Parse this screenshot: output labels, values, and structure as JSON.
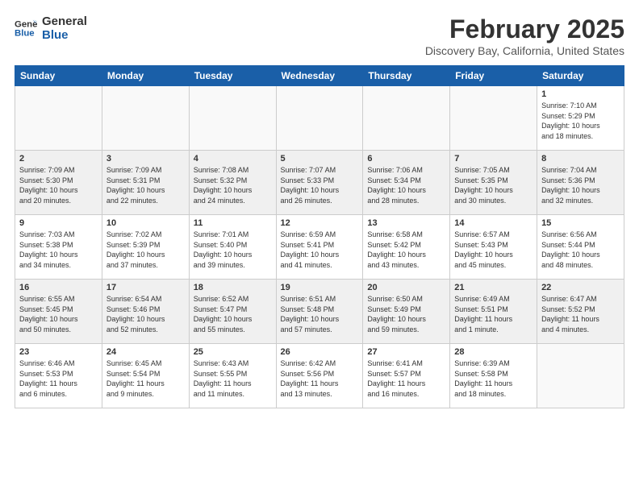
{
  "logo": {
    "line1": "General",
    "line2": "Blue"
  },
  "title": "February 2025",
  "location": "Discovery Bay, California, United States",
  "headers": [
    "Sunday",
    "Monday",
    "Tuesday",
    "Wednesday",
    "Thursday",
    "Friday",
    "Saturday"
  ],
  "weeks": [
    [
      {
        "day": "",
        "info": ""
      },
      {
        "day": "",
        "info": ""
      },
      {
        "day": "",
        "info": ""
      },
      {
        "day": "",
        "info": ""
      },
      {
        "day": "",
        "info": ""
      },
      {
        "day": "",
        "info": ""
      },
      {
        "day": "1",
        "info": "Sunrise: 7:10 AM\nSunset: 5:29 PM\nDaylight: 10 hours\nand 18 minutes."
      }
    ],
    [
      {
        "day": "2",
        "info": "Sunrise: 7:09 AM\nSunset: 5:30 PM\nDaylight: 10 hours\nand 20 minutes."
      },
      {
        "day": "3",
        "info": "Sunrise: 7:09 AM\nSunset: 5:31 PM\nDaylight: 10 hours\nand 22 minutes."
      },
      {
        "day": "4",
        "info": "Sunrise: 7:08 AM\nSunset: 5:32 PM\nDaylight: 10 hours\nand 24 minutes."
      },
      {
        "day": "5",
        "info": "Sunrise: 7:07 AM\nSunset: 5:33 PM\nDaylight: 10 hours\nand 26 minutes."
      },
      {
        "day": "6",
        "info": "Sunrise: 7:06 AM\nSunset: 5:34 PM\nDaylight: 10 hours\nand 28 minutes."
      },
      {
        "day": "7",
        "info": "Sunrise: 7:05 AM\nSunset: 5:35 PM\nDaylight: 10 hours\nand 30 minutes."
      },
      {
        "day": "8",
        "info": "Sunrise: 7:04 AM\nSunset: 5:36 PM\nDaylight: 10 hours\nand 32 minutes."
      }
    ],
    [
      {
        "day": "9",
        "info": "Sunrise: 7:03 AM\nSunset: 5:38 PM\nDaylight: 10 hours\nand 34 minutes."
      },
      {
        "day": "10",
        "info": "Sunrise: 7:02 AM\nSunset: 5:39 PM\nDaylight: 10 hours\nand 37 minutes."
      },
      {
        "day": "11",
        "info": "Sunrise: 7:01 AM\nSunset: 5:40 PM\nDaylight: 10 hours\nand 39 minutes."
      },
      {
        "day": "12",
        "info": "Sunrise: 6:59 AM\nSunset: 5:41 PM\nDaylight: 10 hours\nand 41 minutes."
      },
      {
        "day": "13",
        "info": "Sunrise: 6:58 AM\nSunset: 5:42 PM\nDaylight: 10 hours\nand 43 minutes."
      },
      {
        "day": "14",
        "info": "Sunrise: 6:57 AM\nSunset: 5:43 PM\nDaylight: 10 hours\nand 45 minutes."
      },
      {
        "day": "15",
        "info": "Sunrise: 6:56 AM\nSunset: 5:44 PM\nDaylight: 10 hours\nand 48 minutes."
      }
    ],
    [
      {
        "day": "16",
        "info": "Sunrise: 6:55 AM\nSunset: 5:45 PM\nDaylight: 10 hours\nand 50 minutes."
      },
      {
        "day": "17",
        "info": "Sunrise: 6:54 AM\nSunset: 5:46 PM\nDaylight: 10 hours\nand 52 minutes."
      },
      {
        "day": "18",
        "info": "Sunrise: 6:52 AM\nSunset: 5:47 PM\nDaylight: 10 hours\nand 55 minutes."
      },
      {
        "day": "19",
        "info": "Sunrise: 6:51 AM\nSunset: 5:48 PM\nDaylight: 10 hours\nand 57 minutes."
      },
      {
        "day": "20",
        "info": "Sunrise: 6:50 AM\nSunset: 5:49 PM\nDaylight: 10 hours\nand 59 minutes."
      },
      {
        "day": "21",
        "info": "Sunrise: 6:49 AM\nSunset: 5:51 PM\nDaylight: 11 hours\nand 1 minute."
      },
      {
        "day": "22",
        "info": "Sunrise: 6:47 AM\nSunset: 5:52 PM\nDaylight: 11 hours\nand 4 minutes."
      }
    ],
    [
      {
        "day": "23",
        "info": "Sunrise: 6:46 AM\nSunset: 5:53 PM\nDaylight: 11 hours\nand 6 minutes."
      },
      {
        "day": "24",
        "info": "Sunrise: 6:45 AM\nSunset: 5:54 PM\nDaylight: 11 hours\nand 9 minutes."
      },
      {
        "day": "25",
        "info": "Sunrise: 6:43 AM\nSunset: 5:55 PM\nDaylight: 11 hours\nand 11 minutes."
      },
      {
        "day": "26",
        "info": "Sunrise: 6:42 AM\nSunset: 5:56 PM\nDaylight: 11 hours\nand 13 minutes."
      },
      {
        "day": "27",
        "info": "Sunrise: 6:41 AM\nSunset: 5:57 PM\nDaylight: 11 hours\nand 16 minutes."
      },
      {
        "day": "28",
        "info": "Sunrise: 6:39 AM\nSunset: 5:58 PM\nDaylight: 11 hours\nand 18 minutes."
      },
      {
        "day": "",
        "info": ""
      }
    ]
  ]
}
